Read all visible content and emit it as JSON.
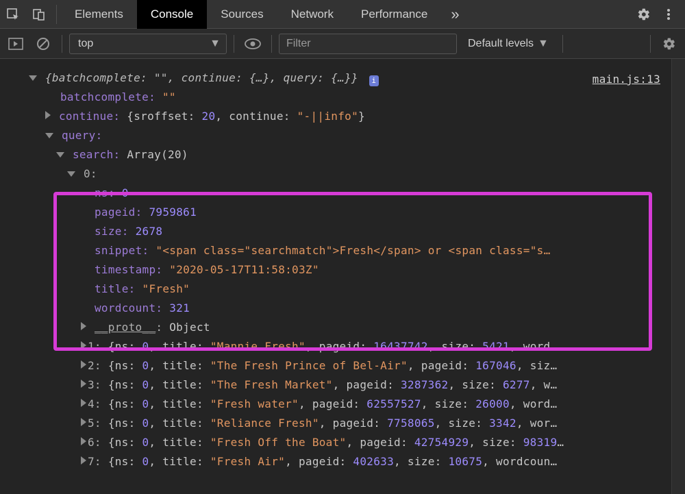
{
  "tabs": {
    "elements": "Elements",
    "console": "Console",
    "sources": "Sources",
    "network": "Network",
    "performance": "Performance"
  },
  "toolbar": {
    "context": "top",
    "filter_placeholder": "Filter",
    "levels": "Default levels"
  },
  "source_link": "main.js:13",
  "root": {
    "summary_prefix": "{batchcomplete: ",
    "summary_mid": ", continue: {…}, query: {…}}",
    "batchcomplete_key": "batchcomplete:",
    "batchcomplete_val": "\"\"",
    "continue_key": "continue:",
    "continue_inline_a": "{sroffset: ",
    "continue_inline_val": "20",
    "continue_inline_b": ", continue: ",
    "continue_inline_str": "\"-||info\"",
    "continue_inline_c": "}",
    "query_key": "query:",
    "search_key": "search:",
    "search_type": "Array(20)",
    "idx0": "0:",
    "ns_key": "ns:",
    "ns_val": "0",
    "pageid_key": "pageid:",
    "pageid_val": "7959861",
    "size_key": "size:",
    "size_val": "2678",
    "snippet_key": "snippet:",
    "snippet_val": "\"<span class=\"searchmatch\">Fresh</span> or <span class=\"s…",
    "timestamp_key": "timestamp:",
    "timestamp_val": "\"2020-05-17T11:58:03Z\"",
    "title_key": "title:",
    "title_val": "\"Fresh\"",
    "wordcount_key": "wordcount:",
    "wordcount_val": "321",
    "proto_key": "__proto__",
    "proto_val": "Object"
  },
  "rows": [
    {
      "idx": "1:",
      "ns": "0",
      "title": "\"Mannie Fresh\"",
      "pageid": "16437742",
      "size": "5421",
      "tail": ", word…"
    },
    {
      "idx": "2:",
      "ns": "0",
      "title": "\"The Fresh Prince of Bel-Air\"",
      "pageid": "167046",
      "size": "",
      "tail": ", siz…"
    },
    {
      "idx": "3:",
      "ns": "0",
      "title": "\"The Fresh Market\"",
      "pageid": "3287362",
      "size": "6277",
      "tail": ", w…"
    },
    {
      "idx": "4:",
      "ns": "0",
      "title": "\"Fresh water\"",
      "pageid": "62557527",
      "size": "26000",
      "tail": ", word…"
    },
    {
      "idx": "5:",
      "ns": "0",
      "title": "\"Reliance Fresh\"",
      "pageid": "7758065",
      "size": "3342",
      "tail": ", wor…"
    },
    {
      "idx": "6:",
      "ns": "0",
      "title": "\"Fresh Off the Boat\"",
      "pageid": "42754929",
      "size": "98319",
      "tail": "…"
    },
    {
      "idx": "7:",
      "ns": "0",
      "title": "\"Fresh Air\"",
      "pageid": "402633",
      "size": "10675",
      "tail": ", wordcoun…"
    }
  ]
}
